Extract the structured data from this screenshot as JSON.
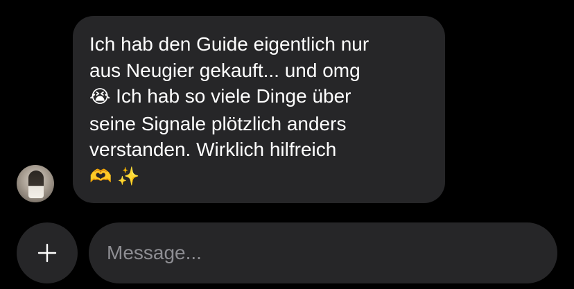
{
  "conversation": {
    "message": {
      "lines": [
        "Ich hab den Guide eigentlich nur",
        "aus Neugier gekauft... und omg",
        "Ich hab so viele Dinge über",
        "seine Signale plötzlich anders",
        "verstanden. Wirklich hilfreich"
      ],
      "emoji_crying": "😭",
      "emoji_heart_hands": "🫶",
      "emoji_sparkles": "✨"
    }
  },
  "composer": {
    "placeholder": "Message...",
    "value": ""
  },
  "icons": {
    "add": "plus-icon",
    "avatar": "user-avatar"
  },
  "colors": {
    "background": "#000000",
    "bubble": "#262628",
    "text": "#ffffff",
    "placeholder": "#8e8e93"
  }
}
